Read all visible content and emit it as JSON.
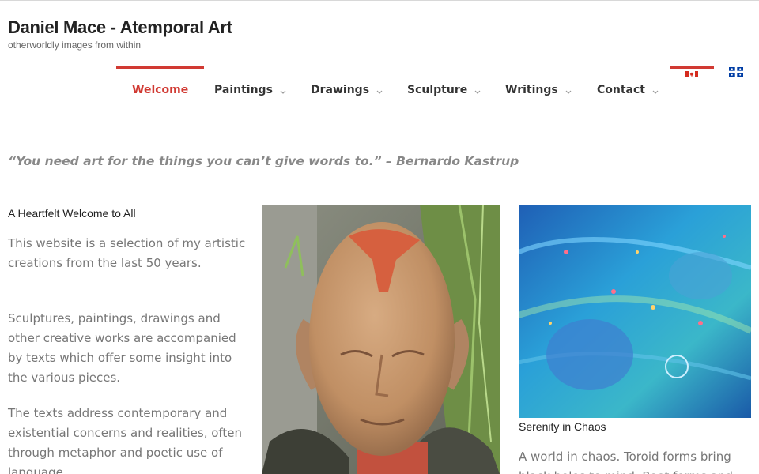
{
  "site": {
    "title": "Daniel Mace - Atemporal Art",
    "tagline": "otherworldly images from within"
  },
  "nav": {
    "items": [
      {
        "label": "Welcome",
        "active": true,
        "has_submenu": false
      },
      {
        "label": "Paintings",
        "active": false,
        "has_submenu": true
      },
      {
        "label": "Drawings",
        "active": false,
        "has_submenu": true
      },
      {
        "label": "Sculpture",
        "active": false,
        "has_submenu": true
      },
      {
        "label": "Writings",
        "active": false,
        "has_submenu": true
      },
      {
        "label": "Contact",
        "active": false,
        "has_submenu": true
      }
    ]
  },
  "languages": [
    {
      "flag": "canada-flag-icon",
      "active": true
    },
    {
      "flag": "quebec-flag-icon",
      "active": false
    }
  ],
  "quote": "“You need art for the things you can’t give words to.” – Bernardo Kastrup",
  "welcome": {
    "heading": "A Heartfelt Welcome to All",
    "paragraphs": [
      "This website is a selection of my artistic creations from the last 50 years.",
      "Sculptures, paintings, drawings and other creative works are accompanied by texts which offer some insight into the various pieces.",
      "The texts address contemporary and existential concerns and realities, often through metaphor and poetic use of language."
    ]
  },
  "featured": {
    "sculpture_image": "sculpted-head-image",
    "painting_image": "painting-image",
    "painting_caption": "Serenity in Chaos",
    "painting_text": "A world in chaos. Toroid forms bring black holes to mind. Root forms and"
  },
  "colors": {
    "accent": "#d13a33",
    "text_dark": "#222222",
    "text_muted": "#777777"
  }
}
